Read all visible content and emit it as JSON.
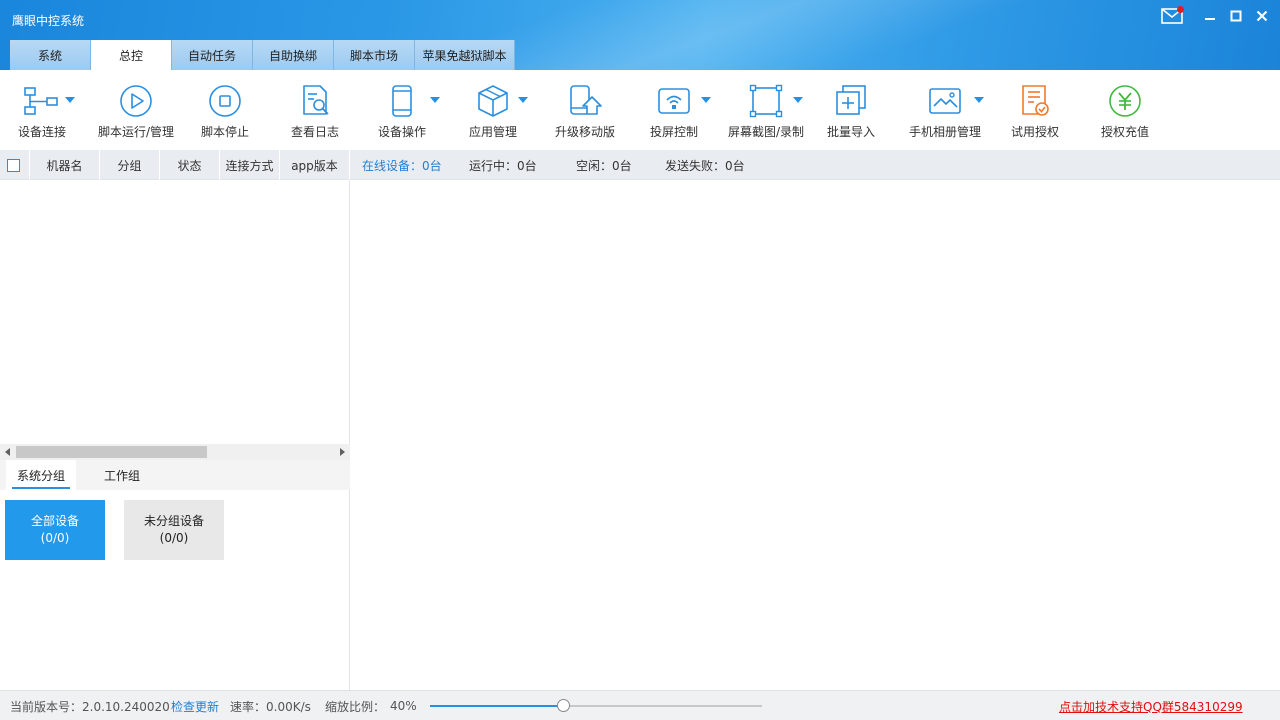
{
  "window": {
    "title": "鹰眼中控系统",
    "controls": {
      "mail_icon": "mail-icon",
      "minimize_icon": "minimize-icon",
      "maximize_icon": "maximize-icon",
      "close_icon": "close-icon"
    }
  },
  "tabs": [
    {
      "label": "系统",
      "active": false
    },
    {
      "label": "总控",
      "active": true
    },
    {
      "label": "自动任务",
      "active": false
    },
    {
      "label": "自助换绑",
      "active": false
    },
    {
      "label": "脚本市场",
      "active": false
    },
    {
      "label": "苹果免越狱脚本",
      "active": false
    }
  ],
  "toolbar": [
    {
      "label": "设备连接",
      "icon": "device-connect-icon",
      "dropdown": true
    },
    {
      "label": "脚本运行/管理",
      "icon": "play-icon",
      "dropdown": false
    },
    {
      "label": "脚本停止",
      "icon": "stop-icon",
      "dropdown": false
    },
    {
      "label": "查看日志",
      "icon": "log-search-icon",
      "dropdown": false
    },
    {
      "label": "设备操作",
      "icon": "phone-icon",
      "dropdown": true
    },
    {
      "label": "应用管理",
      "icon": "package-icon",
      "dropdown": true
    },
    {
      "label": "升级移动版",
      "icon": "upgrade-mobile-icon",
      "dropdown": false
    },
    {
      "label": "投屏控制",
      "icon": "screen-cast-icon",
      "dropdown": true
    },
    {
      "label": "屏幕截图/录制",
      "icon": "screenshot-icon",
      "dropdown": true
    },
    {
      "label": "批量导入",
      "icon": "batch-import-icon",
      "dropdown": false
    },
    {
      "label": "手机相册管理",
      "icon": "image-icon",
      "dropdown": true
    },
    {
      "label": "试用授权",
      "icon": "trial-license-icon",
      "dropdown": false
    },
    {
      "label": "授权充值",
      "icon": "yuan-icon",
      "dropdown": false
    }
  ],
  "table": {
    "columns": [
      "机器名",
      "分组",
      "状态",
      "连接方式",
      "app版本"
    ],
    "status": {
      "online": "在线设备：0台",
      "running": "运行中：0台",
      "idle": "空闲：0台",
      "failed": "发送失败：0台"
    }
  },
  "groups": {
    "tabs": [
      {
        "label": "系统分组",
        "active": true
      },
      {
        "label": "工作组",
        "active": false
      }
    ],
    "cards": [
      {
        "name": "全部设备",
        "count": "(0/0)",
        "selected": true
      },
      {
        "name": "未分组设备",
        "count": "(0/0)",
        "selected": false
      }
    ]
  },
  "statusbar": {
    "version": "当前版本号：2.0.10.240020",
    "check_update": "检查更新",
    "speed": "速率：0.00K/s",
    "zoom_label": "缩放比例：",
    "zoom_value": "40%",
    "zoom_fraction": 0.4,
    "support": "点击加技术支持QQ群584310299"
  },
  "colors": {
    "accent": "#2b8fe0",
    "selected_card": "#2299ea",
    "support_link": "#e01010",
    "trial_icon": "#f07a2b",
    "yuan_icon": "#3fba3f"
  }
}
